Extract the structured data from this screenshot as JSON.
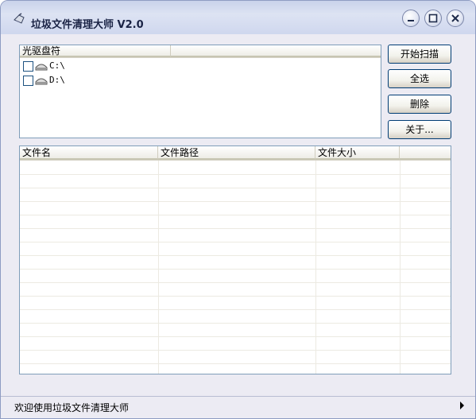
{
  "window": {
    "title": "垃圾文件清理大师 V2.0",
    "app_icon": "broom-icon",
    "controls": [
      "minimize-icon",
      "maximize-icon",
      "close-icon"
    ]
  },
  "drives_panel": {
    "header": "光驱盘符",
    "items": [
      {
        "label": "C:\\",
        "checked": false,
        "icon": "hard-drive-icon"
      },
      {
        "label": "D:\\",
        "checked": false,
        "icon": "hard-drive-icon"
      }
    ]
  },
  "buttons": {
    "scan": "开始扫描",
    "select_all": "全选",
    "delete": "删除",
    "about": "关于..."
  },
  "file_list": {
    "columns": [
      "文件名",
      "文件路径",
      "文件大小",
      ""
    ],
    "rows": []
  },
  "status": {
    "text": "欢迎使用垃圾文件清理大师"
  },
  "colors": {
    "titlebar": "#cfd7ee",
    "window_bg": "#ecebf3",
    "list_border": "#7f9db9",
    "button_border": "#003c74"
  }
}
